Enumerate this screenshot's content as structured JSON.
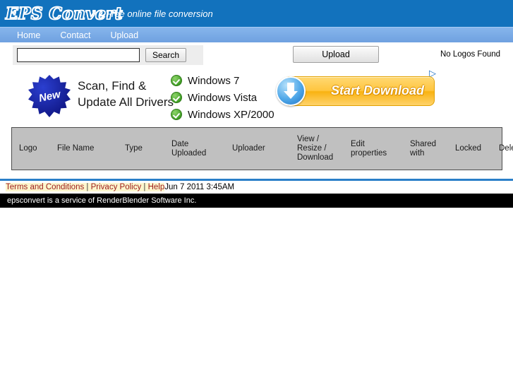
{
  "header": {
    "logo": "EPS Convert",
    "tagline": "Free online file conversion"
  },
  "nav": {
    "items": [
      {
        "label": "Home"
      },
      {
        "label": "Contact"
      },
      {
        "label": "Upload"
      }
    ]
  },
  "toolbar": {
    "search_value": "",
    "search_placeholder": "",
    "search_button": "Search",
    "upload_button": "Upload",
    "status": "No Logos Found"
  },
  "ad": {
    "badge": "New",
    "headline_line1": "Scan, Find &",
    "headline_line2": "Update All Drivers",
    "checklist": [
      {
        "label": "Windows 7"
      },
      {
        "label": "Windows Vista"
      },
      {
        "label": "Windows XP/2000"
      }
    ],
    "cta": "Start Download",
    "adchoices": "▷"
  },
  "table": {
    "columns": [
      {
        "label": "Logo"
      },
      {
        "label": "File Name"
      },
      {
        "label": "Type"
      },
      {
        "label": "Date\nUploaded"
      },
      {
        "label": "Uploader"
      },
      {
        "label": "View /\nResize /\nDownload"
      },
      {
        "label": "Edit\nproperties"
      },
      {
        "label": "Shared\nwith"
      },
      {
        "label": "Locked"
      },
      {
        "label": "Delete"
      }
    ],
    "rows": []
  },
  "footer": {
    "links": [
      {
        "label": "Terms and Conditions"
      },
      {
        "label": "Privacy Policy"
      },
      {
        "label": "Help"
      }
    ],
    "separator": " | ",
    "timestamp": "Jun 7 2011 3:45AM",
    "notice": "epsconvert is a service of RenderBlender Software Inc."
  },
  "colors": {
    "header_blue": "#1272bd",
    "nav_blue": "#7aadea",
    "rule_blue": "#2b7fc9",
    "table_header_gray": "#c0c0c0",
    "link_red": "#9c1b1b",
    "link_highlight": "#fdf6cd",
    "cta_orange": "#ffc63f",
    "check_green": "#3d9c22"
  }
}
